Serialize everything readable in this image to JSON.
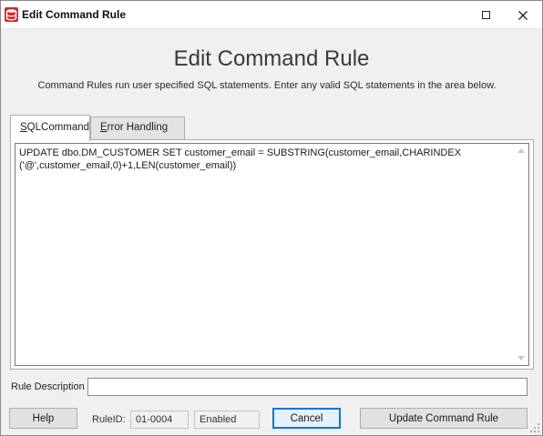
{
  "window": {
    "title": "Edit Command Rule"
  },
  "header": {
    "heading": "Edit Command Rule",
    "subtitle": "Command Rules run user specified SQL statements. Enter any valid SQL statements in the area below."
  },
  "tabs": [
    {
      "label": "SQLCommand",
      "mnemonic": "S",
      "rest": "QLCommand",
      "active": true
    },
    {
      "label": "Error  Handling",
      "mnemonic": "E",
      "rest": "rror  Handling",
      "active": false
    }
  ],
  "editor": {
    "sql": "UPDATE dbo.DM_CUSTOMER SET customer_email = SUBSTRING(customer_email,CHARINDEX\n('@',customer_email,0)+1,LEN(customer_email))"
  },
  "form": {
    "description_label": "Rule Description",
    "description_value": ""
  },
  "footer": {
    "help_label": "Help",
    "rule_id_label": "RuleID:",
    "rule_id_value": "01-0004",
    "status_value": "Enabled",
    "cancel_label": "Cancel",
    "update_label": "Update Command Rule"
  },
  "colors": {
    "focus_border": "#0078d7",
    "button_face": "#e1e1e1",
    "dialog_bg": "#f0f0f0"
  },
  "icons": {
    "app": "sql-rule-icon",
    "maximize": "maximize-icon",
    "close": "close-icon"
  }
}
